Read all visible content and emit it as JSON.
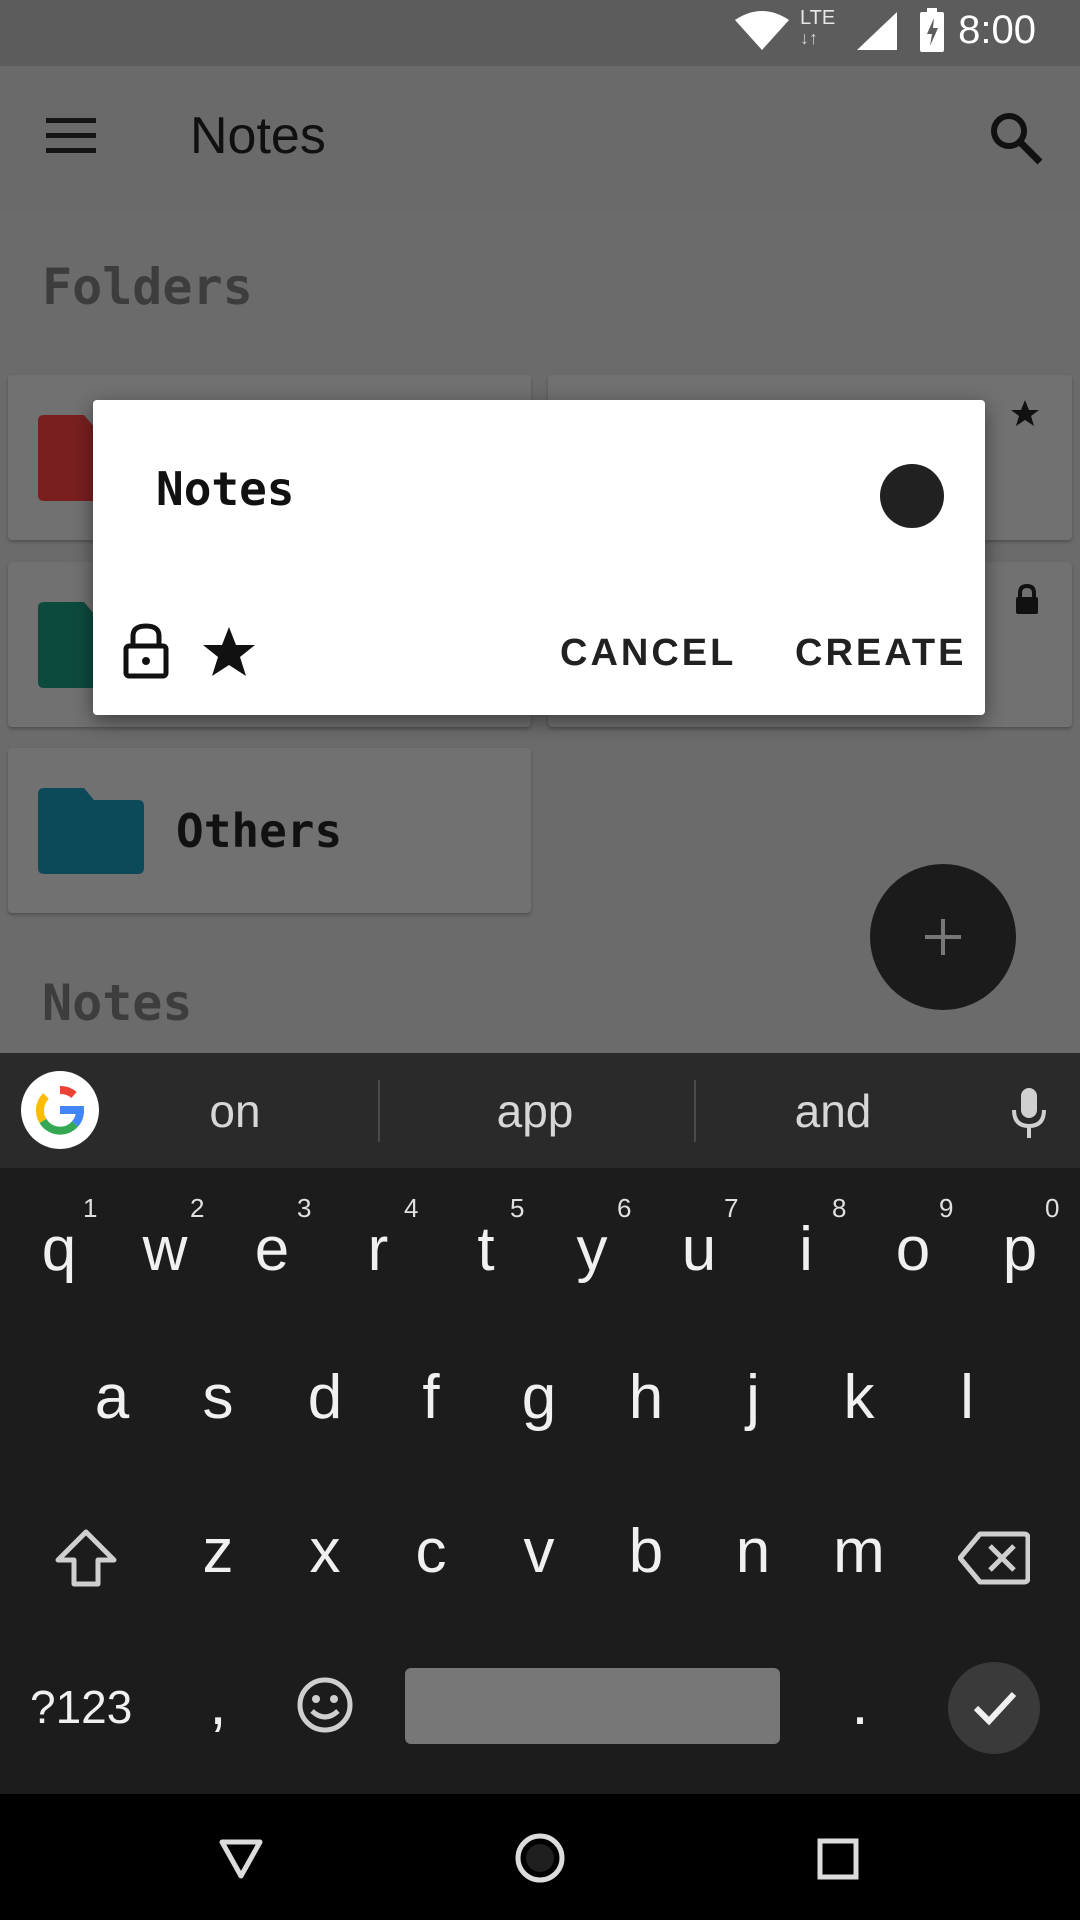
{
  "status_bar": {
    "time": "8:00",
    "network": "LTE"
  },
  "app_bar": {
    "title": "Notes"
  },
  "sections": {
    "folders": "Folders",
    "notes": "Notes"
  },
  "folders": [
    {
      "label": "",
      "color": "#7a1f1f"
    },
    {
      "label": "",
      "color": "#0d4a3e"
    },
    {
      "label": "Others",
      "color": "#0d4a59"
    }
  ],
  "dialog": {
    "name_value": "Notes",
    "color": "#212121",
    "cancel_label": "CANCEL",
    "create_label": "CREATE"
  },
  "keyboard": {
    "suggestions": [
      "on",
      "app",
      "and"
    ],
    "row1": [
      "q",
      "w",
      "e",
      "r",
      "t",
      "y",
      "u",
      "i",
      "o",
      "p"
    ],
    "row1_hints": [
      "1",
      "2",
      "3",
      "4",
      "5",
      "6",
      "7",
      "8",
      "9",
      "0"
    ],
    "row2": [
      "a",
      "s",
      "d",
      "f",
      "g",
      "h",
      "j",
      "k",
      "l"
    ],
    "row3": [
      "z",
      "x",
      "c",
      "v",
      "b",
      "n",
      "m"
    ],
    "symbols_label": "?123",
    "comma": ",",
    "period": "."
  }
}
